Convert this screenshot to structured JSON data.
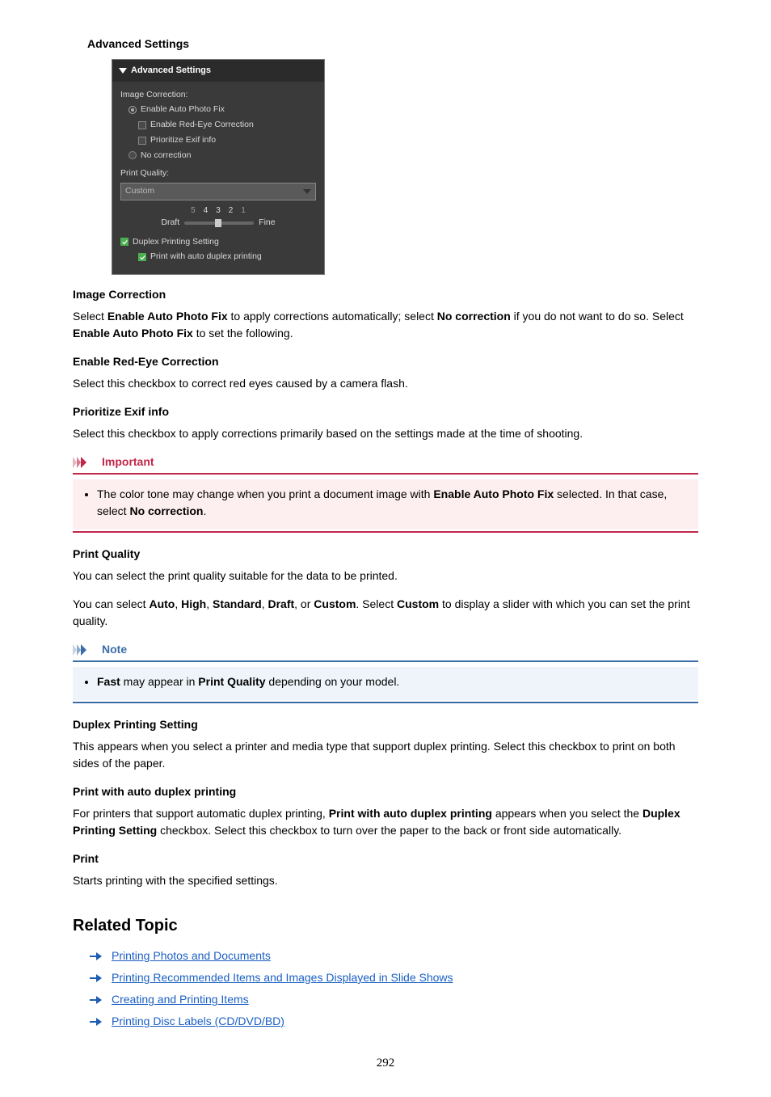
{
  "headings": {
    "advanced_settings": "Advanced Settings",
    "image_correction": "Image Correction",
    "enable_red_eye": "Enable Red-Eye Correction",
    "prioritize_exif": "Prioritize Exif info",
    "print_quality": "Print Quality",
    "duplex_setting": "Duplex Printing Setting",
    "print_with_auto_duplex": "Print with auto duplex printing",
    "print": "Print",
    "related_topic": "Related Topic",
    "important": "Important",
    "note": "Note"
  },
  "panel": {
    "title": "Advanced Settings",
    "image_correction_label": "Image Correction:",
    "enable_auto_photo_fix": "Enable Auto Photo Fix",
    "enable_red_eye": "Enable Red-Eye Correction",
    "prioritize_exif": "Prioritize Exif info",
    "no_correction": "No correction",
    "print_quality_label": "Print Quality:",
    "dropdown_value": "Custom",
    "slider_nums": [
      "5",
      "4",
      "3",
      "2",
      "1"
    ],
    "draft": "Draft",
    "fine": "Fine",
    "duplex_setting": "Duplex Printing Setting",
    "print_auto_duplex": "Print with auto duplex printing"
  },
  "body": {
    "image_correction_p1_a": "Select ",
    "image_correction_p1_b": "Enable Auto Photo Fix",
    "image_correction_p1_c": " to apply corrections automatically; select ",
    "image_correction_p1_d": "No correction",
    "image_correction_p1_e": " if you do not want to do so. Select ",
    "image_correction_p1_f": "Enable Auto Photo Fix",
    "image_correction_p1_g": " to set the following.",
    "red_eye_p": "Select this checkbox to correct red eyes caused by a camera flash.",
    "exif_p": "Select this checkbox to apply corrections primarily based on the settings made at the time of shooting.",
    "important_li_a": "The color tone may change when you print a document image with ",
    "important_li_b": "Enable Auto Photo Fix",
    "important_li_c": " selected. In that case, select ",
    "important_li_d": "No correction",
    "important_li_e": ".",
    "pq_p1": "You can select the print quality suitable for the data to be printed.",
    "pq_p2_a": "You can select ",
    "pq_p2_b": "Auto",
    "pq_p2_c": ", ",
    "pq_p2_d": "High",
    "pq_p2_e": ", ",
    "pq_p2_f": "Standard",
    "pq_p2_g": ", ",
    "pq_p2_h": "Draft",
    "pq_p2_i": ", or ",
    "pq_p2_j": "Custom",
    "pq_p2_k": ". Select ",
    "pq_p2_l": "Custom",
    "pq_p2_m": " to display a slider with which you can set the print quality.",
    "note_li_a": "Fast",
    "note_li_b": " may appear in ",
    "note_li_c": "Print Quality",
    "note_li_d": " depending on your model.",
    "duplex_p": "This appears when you select a printer and media type that support duplex printing. Select this checkbox to print on both sides of the paper.",
    "auto_duplex_p_a": "For printers that support automatic duplex printing, ",
    "auto_duplex_p_b": "Print with auto duplex printing",
    "auto_duplex_p_c": " appears when you select the ",
    "auto_duplex_p_d": "Duplex Printing Setting",
    "auto_duplex_p_e": " checkbox. Select this checkbox to turn over the paper to the back or front side automatically.",
    "print_p": "Starts printing with the specified settings."
  },
  "links": {
    "l1": "Printing Photos and Documents",
    "l2": "Printing Recommended Items and Images Displayed in Slide Shows",
    "l3": "Creating and Printing Items",
    "l4": "Printing Disc Labels (CD/DVD/BD)"
  },
  "page_number": "292"
}
